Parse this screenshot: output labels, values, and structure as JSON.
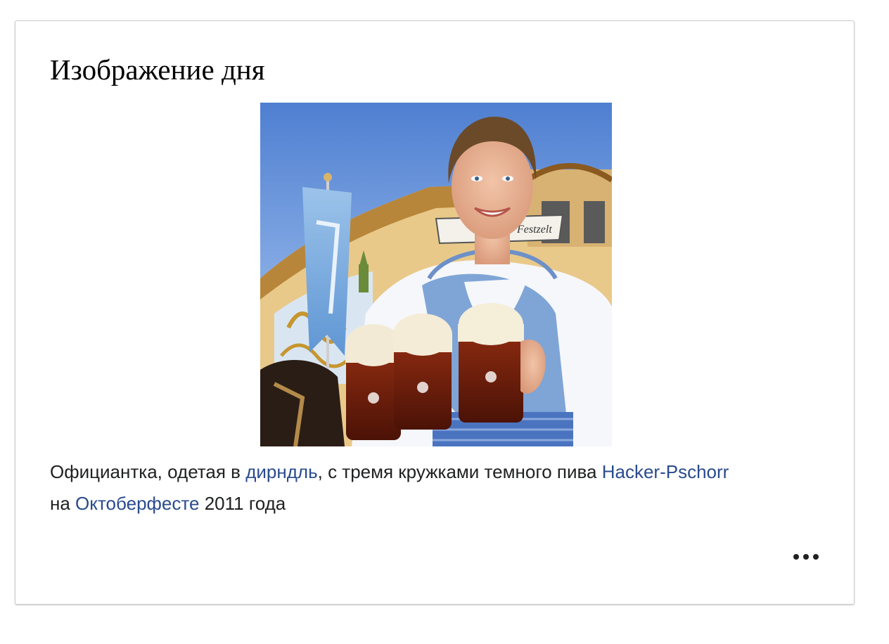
{
  "card": {
    "title": "Изображение дня",
    "image_alt": "Официантка с тремя кружками пива на Октоберфесте",
    "image_sign_text": "Festzelt",
    "caption": {
      "part1": "Официантка, одетая в ",
      "link1": "дирндль",
      "part2": ", с тремя кружками темного пива ",
      "link2": "Hacker-Pschorr",
      "part3": " на ",
      "link3": "Октоберфесте",
      "part4": " 2011 года"
    },
    "more_icon": "more-horizontal-icon"
  },
  "colors": {
    "link": "#2a4b8d",
    "text": "#202122",
    "border": "#c8ccd1"
  }
}
